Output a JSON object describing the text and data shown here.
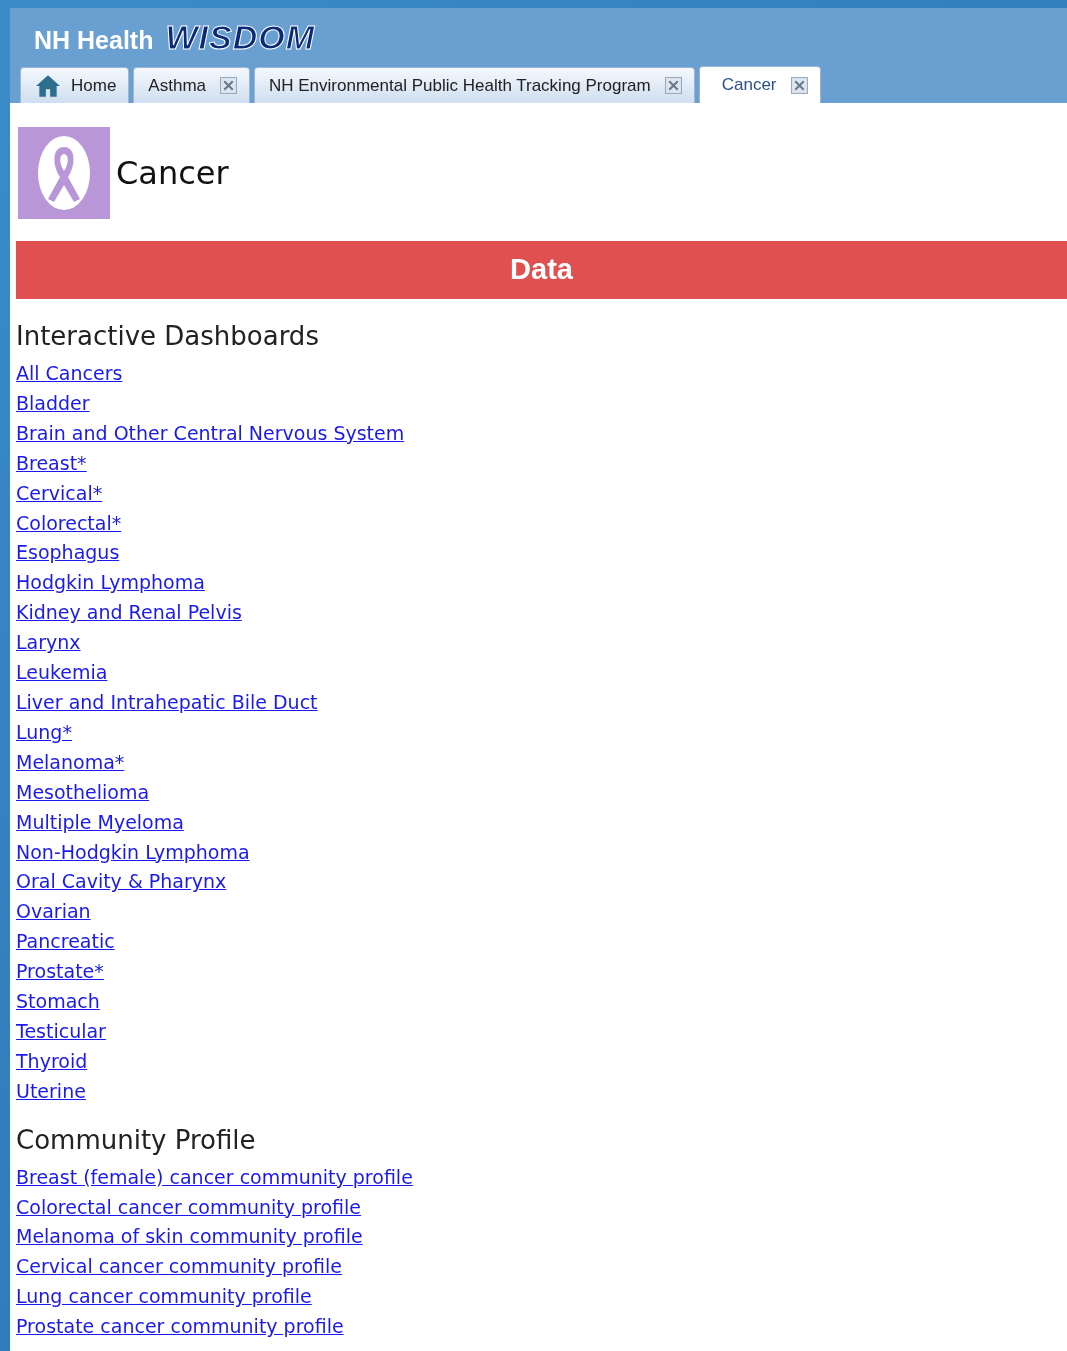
{
  "brand": {
    "prefix": "NH Health",
    "name": "WISDOM"
  },
  "tabs": [
    {
      "label": "Home",
      "kind": "home",
      "selected": false
    },
    {
      "label": "Asthma",
      "kind": "closable",
      "selected": false
    },
    {
      "label": "NH Environmental Public Health Tracking Program",
      "kind": "closable",
      "selected": false
    },
    {
      "label": "Cancer",
      "kind": "closable",
      "selected": true
    }
  ],
  "page_title": "Cancer",
  "banner": "Data",
  "sections": [
    {
      "heading": "Interactive Dashboards",
      "links": [
        "All Cancers",
        "Bladder",
        "Brain and Other Central Nervous System",
        "Breast*",
        "Cervical*",
        "Colorectal*",
        "Esophagus",
        "Hodgkin Lymphoma",
        "Kidney and Renal Pelvis",
        "Larynx",
        "Leukemia",
        "Liver and Intrahepatic Bile Duct",
        "Lung*",
        "Melanoma*",
        "Mesothelioma",
        "Multiple Myeloma",
        "Non-Hodgkin Lymphoma",
        "Oral Cavity & Pharynx",
        "Ovarian",
        "Pancreatic",
        "Prostate*",
        "Stomach",
        "Testicular",
        "Thyroid",
        "Uterine"
      ]
    },
    {
      "heading": "Community Profile",
      "links": [
        "Breast (female) cancer community profile",
        "Colorectal cancer community profile",
        "Melanoma of skin community profile",
        "Cervical cancer community profile",
        "Lung cancer community profile",
        "Prostate cancer community profile"
      ]
    }
  ]
}
